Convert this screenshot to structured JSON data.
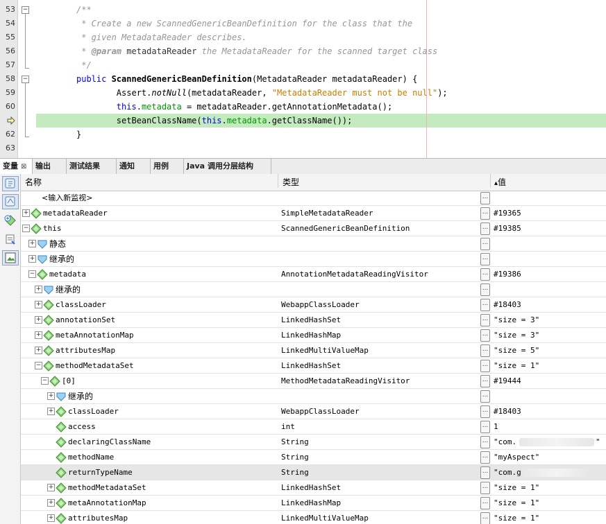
{
  "editor": {
    "lines": [
      {
        "num": "53",
        "segments": [
          {
            "t": "/**",
            "c": "cm"
          }
        ]
      },
      {
        "num": "54",
        "segments": [
          {
            "t": " * Create a new ScannedGenericBeanDefinition for the class that the",
            "c": "cm"
          }
        ]
      },
      {
        "num": "55",
        "segments": [
          {
            "t": " * given MetadataReader describes.",
            "c": "cm"
          }
        ]
      },
      {
        "num": "56",
        "segments": [
          {
            "t": " * ",
            "c": "cm"
          },
          {
            "t": "@param",
            "c": "cm bold"
          },
          {
            "t": " metadataReader",
            "c": "cmnorm"
          },
          {
            "t": " the MetadataReader for the scanned target class",
            "c": "cm"
          }
        ]
      },
      {
        "num": "57",
        "segments": [
          {
            "t": " */",
            "c": "cm"
          }
        ]
      },
      {
        "num": "58",
        "segments": [
          {
            "t": "public ",
            "c": "kw"
          },
          {
            "t": "ScannedGenericBeanDefinition",
            "c": "bold"
          },
          {
            "t": "(MetadataReader metadataReader) {",
            "c": ""
          }
        ]
      },
      {
        "num": "59",
        "segments": [
          {
            "t": "        Assert.",
            "c": ""
          },
          {
            "t": "notNull",
            "c": "ital"
          },
          {
            "t": "(metadataReader, ",
            "c": ""
          },
          {
            "t": "\"MetadataReader must not be null\"",
            "c": "str"
          },
          {
            "t": ");",
            "c": ""
          }
        ]
      },
      {
        "num": "60",
        "segments": [
          {
            "t": "        ",
            "c": ""
          },
          {
            "t": "this",
            "c": "kw"
          },
          {
            "t": ".",
            "c": ""
          },
          {
            "t": "metadata",
            "c": "fld"
          },
          {
            "t": " = metadataReader.getAnnotationMetadata();",
            "c": ""
          }
        ]
      },
      {
        "num": "",
        "segments": [
          {
            "t": "        setBeanClassName(",
            "c": ""
          },
          {
            "t": "this",
            "c": "kw"
          },
          {
            "t": ".",
            "c": ""
          },
          {
            "t": "metadata",
            "c": "fld"
          },
          {
            "t": ".getClassName());",
            "c": ""
          }
        ]
      },
      {
        "num": "62",
        "segments": [
          {
            "t": "}",
            "c": ""
          }
        ]
      },
      {
        "num": "63",
        "segments": []
      }
    ]
  },
  "tabs": [
    {
      "label": "变量",
      "close": "⊠"
    },
    {
      "label": "输出"
    },
    {
      "label": "测试结果"
    },
    {
      "label": "通知"
    },
    {
      "label": "用例"
    },
    {
      "label": "Java 调用分层结构"
    }
  ],
  "table": {
    "col_name": "名称",
    "col_type": "类型",
    "col_value": "值",
    "sort_indicator": "▴",
    "watch_placeholder": "<输入新监视>",
    "rows": [
      {
        "depth": 0,
        "exp": "+",
        "icon": "diamond",
        "name": "metadataReader",
        "type": "SimpleMetadataReader",
        "value": "#19365"
      },
      {
        "depth": 0,
        "exp": "−",
        "icon": "diamond",
        "name": "this",
        "type": "ScannedGenericBeanDefinition",
        "value": "#19385"
      },
      {
        "depth": 1,
        "exp": "+",
        "icon": "shield",
        "name": "静态",
        "type": "",
        "value": ""
      },
      {
        "depth": 1,
        "exp": "+",
        "icon": "shield",
        "name": "继承的",
        "type": "",
        "value": ""
      },
      {
        "depth": 1,
        "exp": "−",
        "icon": "diamond",
        "name": "metadata",
        "type": "AnnotationMetadataReadingVisitor",
        "value": "#19386"
      },
      {
        "depth": 2,
        "exp": "+",
        "icon": "shield",
        "name": "继承的",
        "type": "",
        "value": ""
      },
      {
        "depth": 2,
        "exp": "+",
        "icon": "diamond",
        "name": "classLoader",
        "type": "WebappClassLoader",
        "value": "#18403"
      },
      {
        "depth": 2,
        "exp": "+",
        "icon": "diamond",
        "name": "annotationSet",
        "type": "LinkedHashSet",
        "value": "\"size = 3\""
      },
      {
        "depth": 2,
        "exp": "+",
        "icon": "diamond",
        "name": "metaAnnotationMap",
        "type": "LinkedHashMap",
        "value": "\"size = 3\""
      },
      {
        "depth": 2,
        "exp": "+",
        "icon": "diamond",
        "name": "attributesMap",
        "type": "LinkedMultiValueMap",
        "value": "\"size = 5\""
      },
      {
        "depth": 2,
        "exp": "−",
        "icon": "diamond",
        "name": "methodMetadataSet",
        "type": "LinkedHashSet",
        "value": "\"size = 1\""
      },
      {
        "depth": 3,
        "exp": "−",
        "icon": "diamond",
        "name": "[0]",
        "type": "MethodMetadataReadingVisitor",
        "value": "#19444"
      },
      {
        "depth": 4,
        "exp": "+",
        "icon": "shield",
        "name": "继承的",
        "type": "",
        "value": ""
      },
      {
        "depth": 4,
        "exp": "+",
        "icon": "diamond",
        "name": "classLoader",
        "type": "WebappClassLoader",
        "value": "#18403"
      },
      {
        "depth": 4,
        "exp": "",
        "icon": "diamond",
        "name": "access",
        "type": "int",
        "value": "1"
      },
      {
        "depth": 4,
        "exp": "",
        "icon": "diamond",
        "name": "declaringClassName",
        "type": "String",
        "value": "\"com.",
        "blur": true,
        "tail": "\""
      },
      {
        "depth": 4,
        "exp": "",
        "icon": "diamond",
        "name": "methodName",
        "type": "String",
        "value": "\"myAspect\""
      },
      {
        "depth": 4,
        "exp": "",
        "icon": "diamond",
        "name": "returnTypeName",
        "type": "String",
        "value": "\"com.g",
        "blur": true,
        "selected": true
      },
      {
        "depth": 4,
        "exp": "+",
        "icon": "diamond",
        "name": "methodMetadataSet",
        "type": "LinkedHashSet",
        "value": "\"size = 1\""
      },
      {
        "depth": 4,
        "exp": "+",
        "icon": "diamond",
        "name": "metaAnnotationMap",
        "type": "LinkedHashMap",
        "value": "\"size = 1\""
      },
      {
        "depth": 4,
        "exp": "+",
        "icon": "diamond",
        "name": "attributesMap",
        "type": "LinkedMultiValueMap",
        "value": "\"size = 1\""
      }
    ]
  },
  "value_button_label": "..."
}
